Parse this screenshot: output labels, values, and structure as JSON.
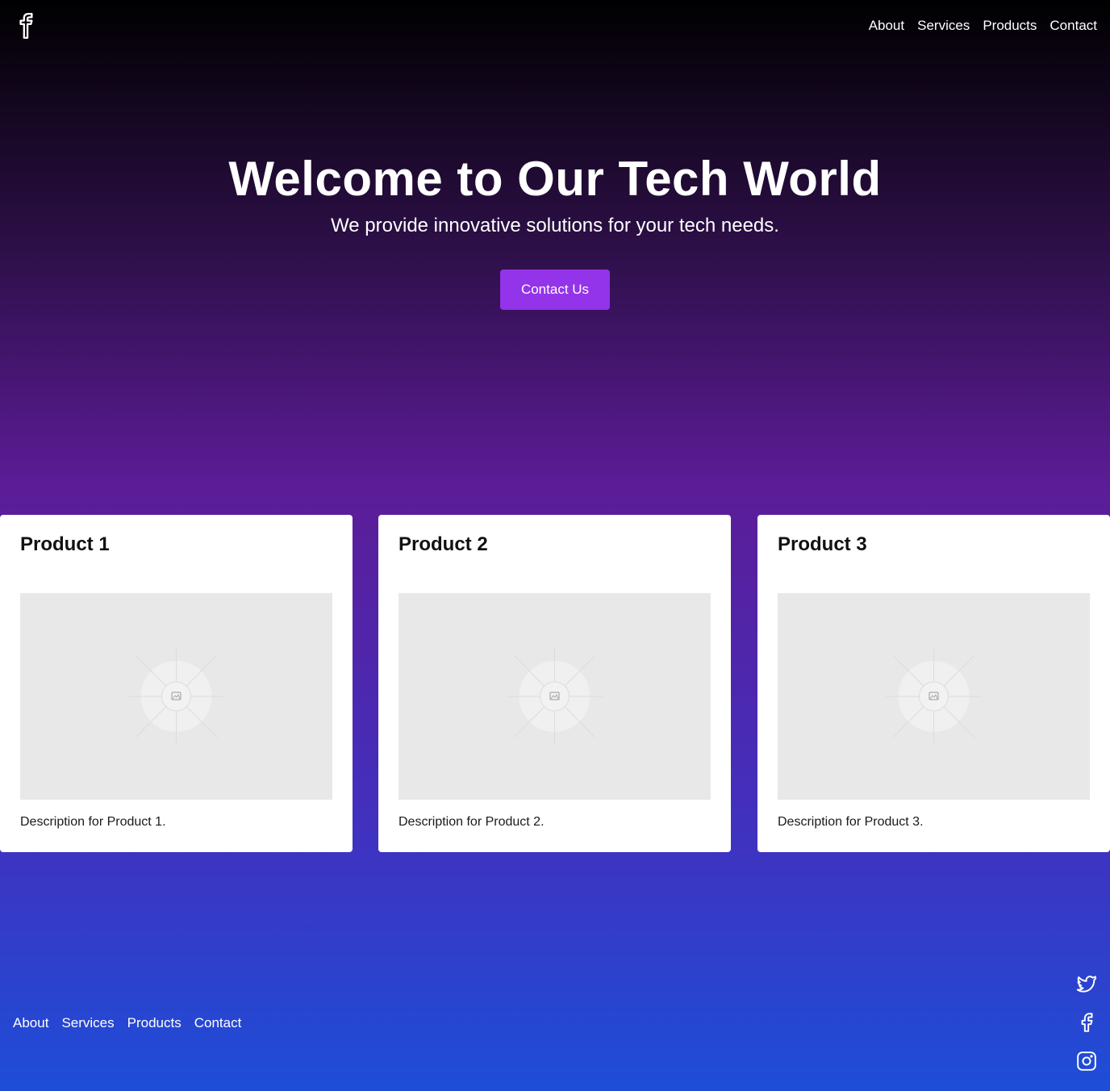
{
  "header": {
    "logo_icon": "facebook-icon",
    "nav": [
      {
        "label": "About"
      },
      {
        "label": "Services"
      },
      {
        "label": "Products"
      },
      {
        "label": "Contact"
      }
    ]
  },
  "hero": {
    "title": "Welcome to Our Tech World",
    "subtitle": "We provide innovative solutions for your tech needs.",
    "cta_label": "Contact Us"
  },
  "products": [
    {
      "title": "Product 1",
      "description": "Description for Product 1.",
      "image_icon": "image-placeholder-icon"
    },
    {
      "title": "Product 2",
      "description": "Description for Product 2.",
      "image_icon": "image-placeholder-icon"
    },
    {
      "title": "Product 3",
      "description": "Description for Product 3.",
      "image_icon": "image-placeholder-icon"
    }
  ],
  "footer": {
    "nav": [
      {
        "label": "About"
      },
      {
        "label": "Services"
      },
      {
        "label": "Products"
      },
      {
        "label": "Contact"
      }
    ],
    "social": [
      "twitter-icon",
      "facebook-icon",
      "instagram-icon"
    ]
  },
  "colors": {
    "accent": "#9333ea",
    "gradient_top": "#000000",
    "gradient_mid": "#5c1c97",
    "gradient_bottom": "#1d4ed8"
  }
}
